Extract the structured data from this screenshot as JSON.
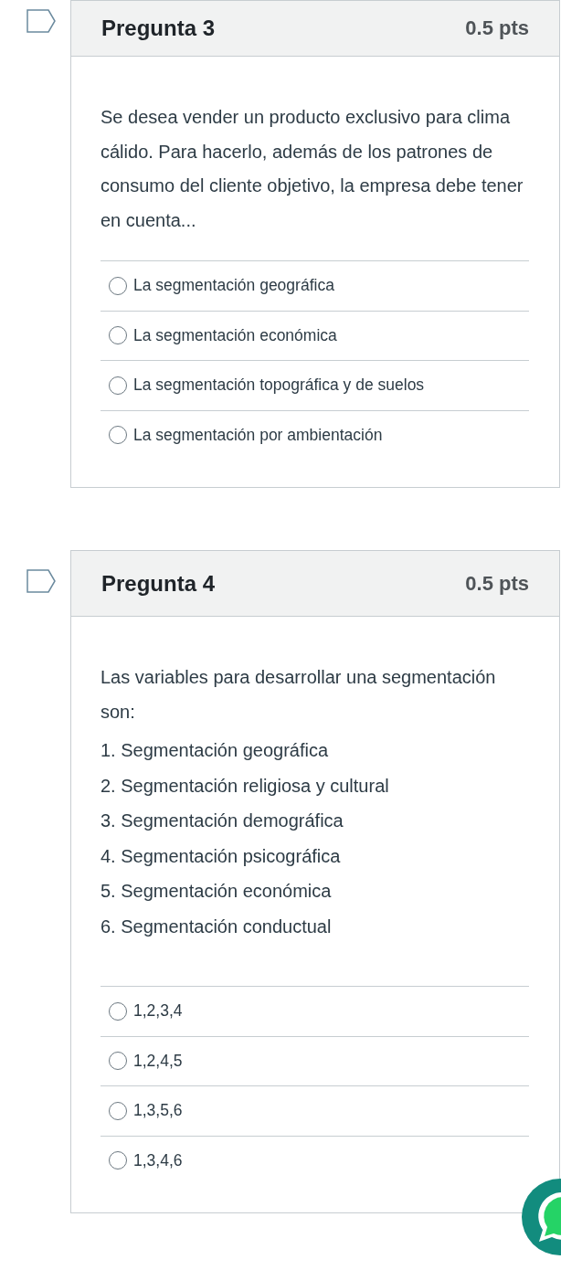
{
  "questions": [
    {
      "title": "Pregunta 3",
      "points": "0.5 pts",
      "text": "Se desea vender un producto exclusivo para clima cálido. Para hacerlo, además de los patrones de consumo del cliente objetivo, la empresa debe tener en cuenta...",
      "answers": [
        {
          "label": "La segmentación geográfica",
          "selected": false
        },
        {
          "label": "La segmentación económica",
          "selected": false
        },
        {
          "label": "La segmentación topográfica y de suelos",
          "selected": false
        },
        {
          "label": "La segmentación por ambientación",
          "selected": false
        }
      ]
    },
    {
      "title": "Pregunta 4",
      "points": "0.5 pts",
      "text": "Las variables para desarrollar una segmentación son:",
      "items": [
        "1. Segmentación geográfica",
        "2. Segmentación religiosa y cultural",
        "3. Segmentación demográfica",
        "4. Segmentación psicográfica",
        "5. Segmentación económica",
        "6. Segmentación conductual"
      ],
      "answers": [
        {
          "label": "1,2,3,4",
          "selected": false
        },
        {
          "label": "1,2,4,5",
          "selected": false
        },
        {
          "label": "1,3,5,6",
          "selected": false
        },
        {
          "label": "1,3,4,6",
          "selected": false
        }
      ]
    }
  ]
}
